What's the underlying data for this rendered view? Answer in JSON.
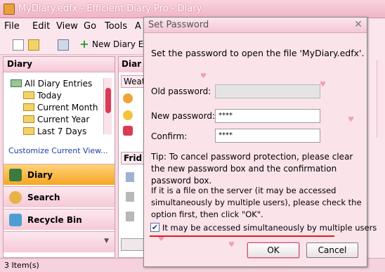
{
  "window": {
    "title": "MyDiary.edfx - Efficient Diary Pro - Diary"
  },
  "menu": [
    "File",
    "Edit",
    "View",
    "Go",
    "Tools",
    "A"
  ],
  "toolbar": {
    "new_label": "New Diary E"
  },
  "left_pane": {
    "header": "Diary",
    "tree": [
      "All Diary Entries",
      "Today",
      "Current Month",
      "Current Year",
      "Last 7 Days"
    ],
    "customize_link": "Customize Current View...",
    "nav": {
      "diary": "Diary",
      "search": "Search",
      "recycle": "Recycle Bin"
    }
  },
  "mid_pane": {
    "header": "Diar",
    "tab_weather": "Weat",
    "day": "Frid"
  },
  "status": "3 Item(s)",
  "dialog": {
    "title": "Set Password",
    "prompt": "Set the password to open the file 'MyDiary.edfx'.",
    "old_label": "Old password:",
    "old_value": "",
    "new_label": "New password:",
    "new_value": "****",
    "confirm_label": "Confirm:",
    "confirm_value": "****",
    "tip": "Tip: To cancel password protection, please clear the new password box and the confirmation password box.",
    "server_note": "If it is a file on the server (it may be accessed simultaneously by multiple users), please check the option first, then click \"OK\".",
    "checkbox_label": "It may be accessed simultaneously by multiple users",
    "checkbox_checked": true,
    "ok_label": "OK",
    "cancel_label": "Cancel"
  }
}
